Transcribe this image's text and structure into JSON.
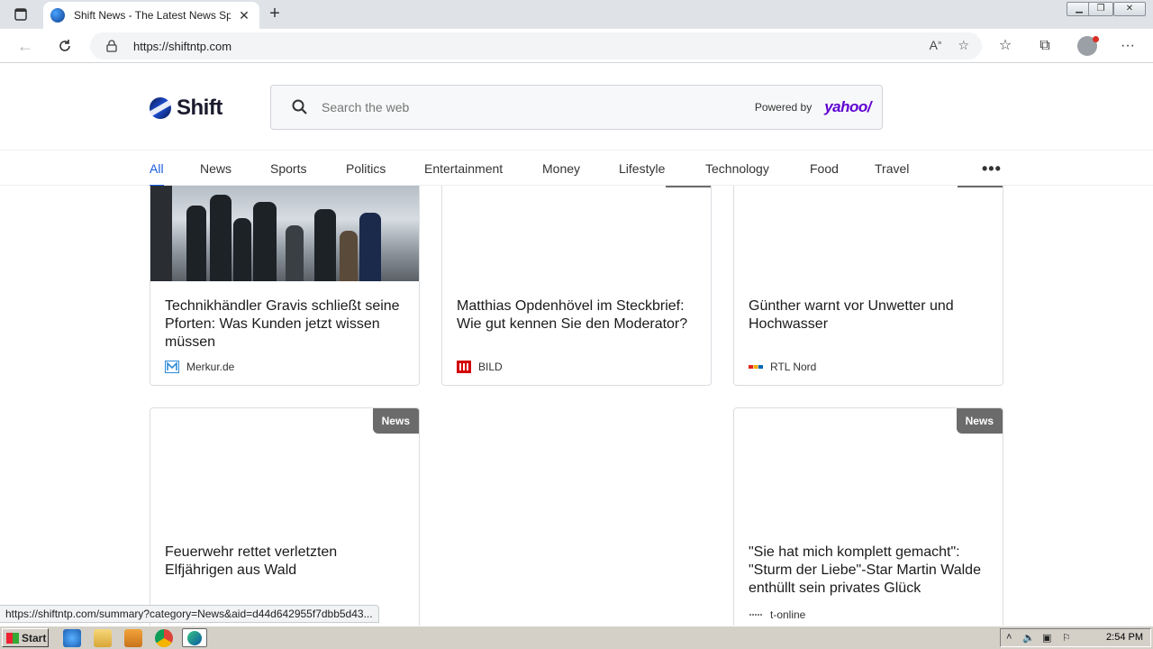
{
  "browser": {
    "tab_title": "Shift News - The Latest News Spo",
    "url": "https://shiftntp.com",
    "status_url": "https://shiftntp.com/summary?category=News&aid=d44d642955f7dbb5d43..."
  },
  "header": {
    "logo_text": "Shift",
    "search_placeholder": "Search the web",
    "powered_by": "Powered by",
    "provider": "yahoo/"
  },
  "nav": {
    "items": [
      "All",
      "News",
      "Sports",
      "Politics",
      "Entertainment",
      "Money",
      "Lifestyle",
      "Technology",
      "Food",
      "Travel"
    ],
    "more": "•••"
  },
  "cards": [
    {
      "headline": "Technikhändler Gravis schließt seine Pforten: Was Kunden jetzt wissen müssen",
      "source": "Merkur.de"
    },
    {
      "headline": "Matthias Opdenhövel im Steckbrief: Wie gut kennen Sie den Moderator?",
      "source": "BILD"
    },
    {
      "headline": "Günther warnt vor Unwetter und Hochwasser",
      "source": "RTL Nord"
    },
    {
      "headline": "Feuerwehr rettet verletzten Elfjährigen aus Wald",
      "source": "",
      "badge": "News"
    },
    {
      "headline": "\"Sie hat mich komplett gemacht\": \"Sturm der Liebe\"-Star Martin Walde enthüllt sein privates Glück",
      "source": "t-online",
      "badge": "News"
    }
  ],
  "taskbar": {
    "start": "Start",
    "clock": "2:54 PM"
  },
  "colors": {
    "accent": "#1a5de0",
    "badge": "#6b6b6b",
    "yahoo": "#6001d2"
  }
}
